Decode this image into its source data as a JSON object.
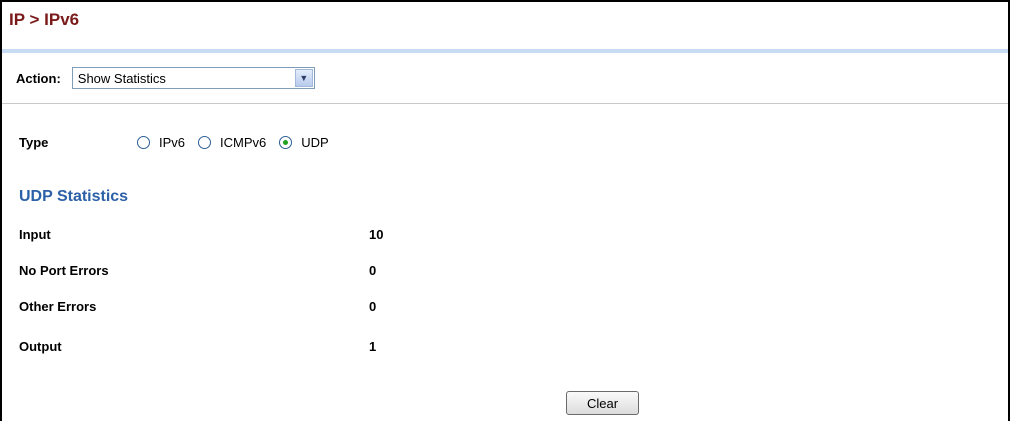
{
  "header": {
    "breadcrumb": "IP > IPv6"
  },
  "action": {
    "label": "Action:",
    "selected": "Show Statistics",
    "arrow_icon": "chevron-down-icon"
  },
  "type": {
    "label": "Type",
    "options": [
      {
        "label": "IPv6",
        "checked": false
      },
      {
        "label": "ICMPv6",
        "checked": false
      },
      {
        "label": "UDP",
        "checked": true
      }
    ]
  },
  "stats": {
    "title": "UDP Statistics",
    "rows": [
      {
        "label": "Input",
        "value": "10"
      },
      {
        "label": "No Port Errors",
        "value": "0"
      },
      {
        "label": "Other Errors",
        "value": "0"
      },
      {
        "label": "Output",
        "value": "1"
      }
    ]
  },
  "buttons": {
    "clear": "Clear"
  },
  "colors": {
    "breadcrumb": "#7a1a1a",
    "section_title": "#2c61a7",
    "title_border": "#c7dcf2"
  }
}
